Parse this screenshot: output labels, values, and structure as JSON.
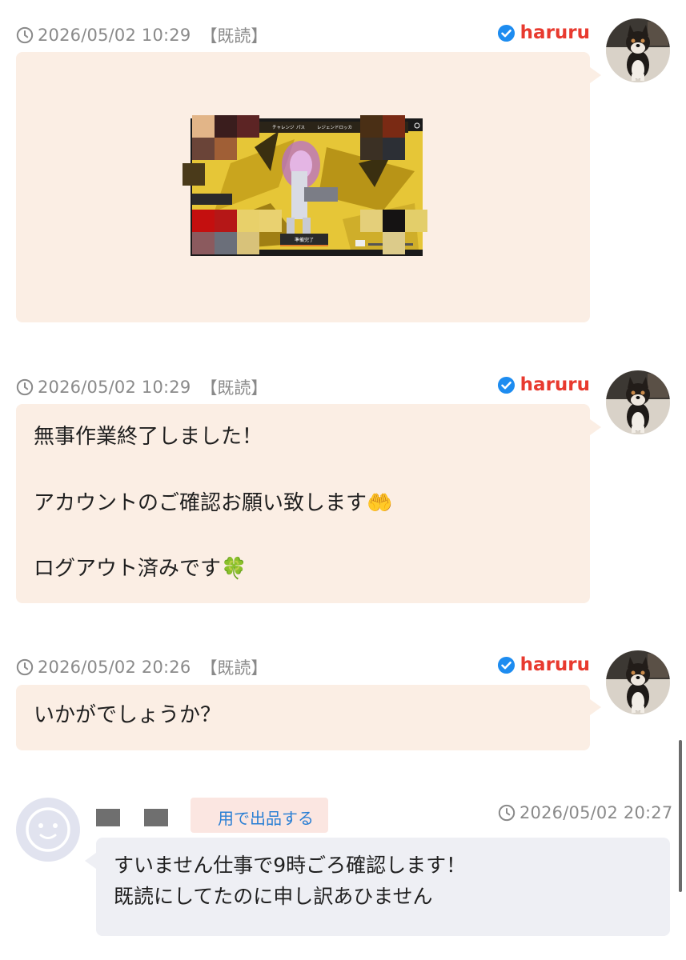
{
  "messages": [
    {
      "timestamp": "2026/05/02 10:29",
      "read_status": "【既読】",
      "sender": "haruru",
      "type": "image",
      "image": {
        "tabs": [
          "チャレンジ",
          "パス",
          "レジェンドロッカ"
        ],
        "button_label": "準備完了"
      }
    },
    {
      "timestamp": "2026/05/02 10:29",
      "read_status": "【既読】",
      "sender": "haruru",
      "type": "text",
      "lines": [
        "無事作業終了しました！",
        "アカウントのご確認お願い致します",
        "ログアウト済みです"
      ],
      "emojis": [
        "🤲",
        "🍀"
      ]
    },
    {
      "timestamp": "2026/05/02 20:26",
      "read_status": "【既読】",
      "sender": "haruru",
      "type": "text",
      "lines": [
        "いかがでしょうか？"
      ]
    },
    {
      "timestamp": "2026/05/02 20:27",
      "sender_tag": "用で出品する",
      "type": "text",
      "lines": [
        "すいません仕事で9時ごろ確認します！",
        "既読にしてたのに申し訳あひません"
      ]
    }
  ],
  "icons": {
    "clock": "clock-icon",
    "verified": "verified-check-icon",
    "avatar_dog": "shiba-dog-avatar",
    "avatar_default": "default-face-avatar"
  },
  "colors": {
    "sender_red": "#e83a2f",
    "verified_blue": "#1d8cf0",
    "bubble_self": "#fbeee4",
    "bubble_other": "#eeeff4",
    "tag_blue": "#2a7fd4",
    "meta_gray": "#8a8a8a"
  }
}
